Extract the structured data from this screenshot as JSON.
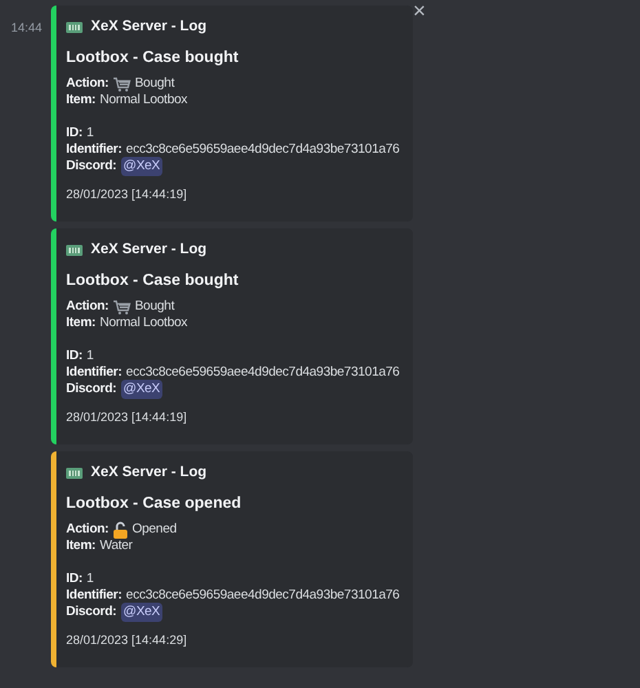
{
  "timestamp": "14:44",
  "close": "×",
  "embeds": [
    {
      "color": "#23d160",
      "author": "XeX Server - Log",
      "title": "Lootbox - Case bought",
      "groups": [
        [
          {
            "kind": "text",
            "label": "Action:",
            "value": "Bought",
            "icon": {
              "kind": "cart"
            }
          },
          {
            "kind": "text",
            "label": "Item:",
            "value": "Normal Lootbox"
          }
        ],
        [
          {
            "kind": "text",
            "label": "ID:",
            "value": "1"
          },
          {
            "kind": "text",
            "label": "Identifier:",
            "value": "ecc3c8ce6e59659aee4d9dec7d4a93be73101a76"
          },
          {
            "kind": "mention",
            "label": "Discord:",
            "value": "@XeX"
          }
        ]
      ],
      "footer": "28/01/2023 [14:44:19]"
    },
    {
      "color": "#23d160",
      "author": "XeX Server - Log",
      "title": "Lootbox - Case bought",
      "groups": [
        [
          {
            "kind": "text",
            "label": "Action:",
            "value": "Bought",
            "icon": {
              "kind": "cart"
            }
          },
          {
            "kind": "text",
            "label": "Item:",
            "value": "Normal Lootbox"
          }
        ],
        [
          {
            "kind": "text",
            "label": "ID:",
            "value": "1"
          },
          {
            "kind": "text",
            "label": "Identifier:",
            "value": "ecc3c8ce6e59659aee4d9dec7d4a93be73101a76"
          },
          {
            "kind": "mention",
            "label": "Discord:",
            "value": "@XeX"
          }
        ]
      ],
      "footer": "28/01/2023 [14:44:19]"
    },
    {
      "color": "#f0b232",
      "author": "XeX Server - Log",
      "title": "Lootbox - Case opened",
      "groups": [
        [
          {
            "kind": "text",
            "label": "Action:",
            "value": "Opened",
            "icon": {
              "kind": "lock"
            }
          },
          {
            "kind": "text",
            "label": "Item:",
            "value": "Water"
          }
        ],
        [
          {
            "kind": "text",
            "label": "ID:",
            "value": "1"
          },
          {
            "kind": "text",
            "label": "Identifier:",
            "value": "ecc3c8ce6e59659aee4d9dec7d4a93be73101a76"
          },
          {
            "kind": "mention",
            "label": "Discord:",
            "value": "@XeX"
          }
        ]
      ],
      "footer": "28/01/2023 [14:44:29]"
    }
  ]
}
